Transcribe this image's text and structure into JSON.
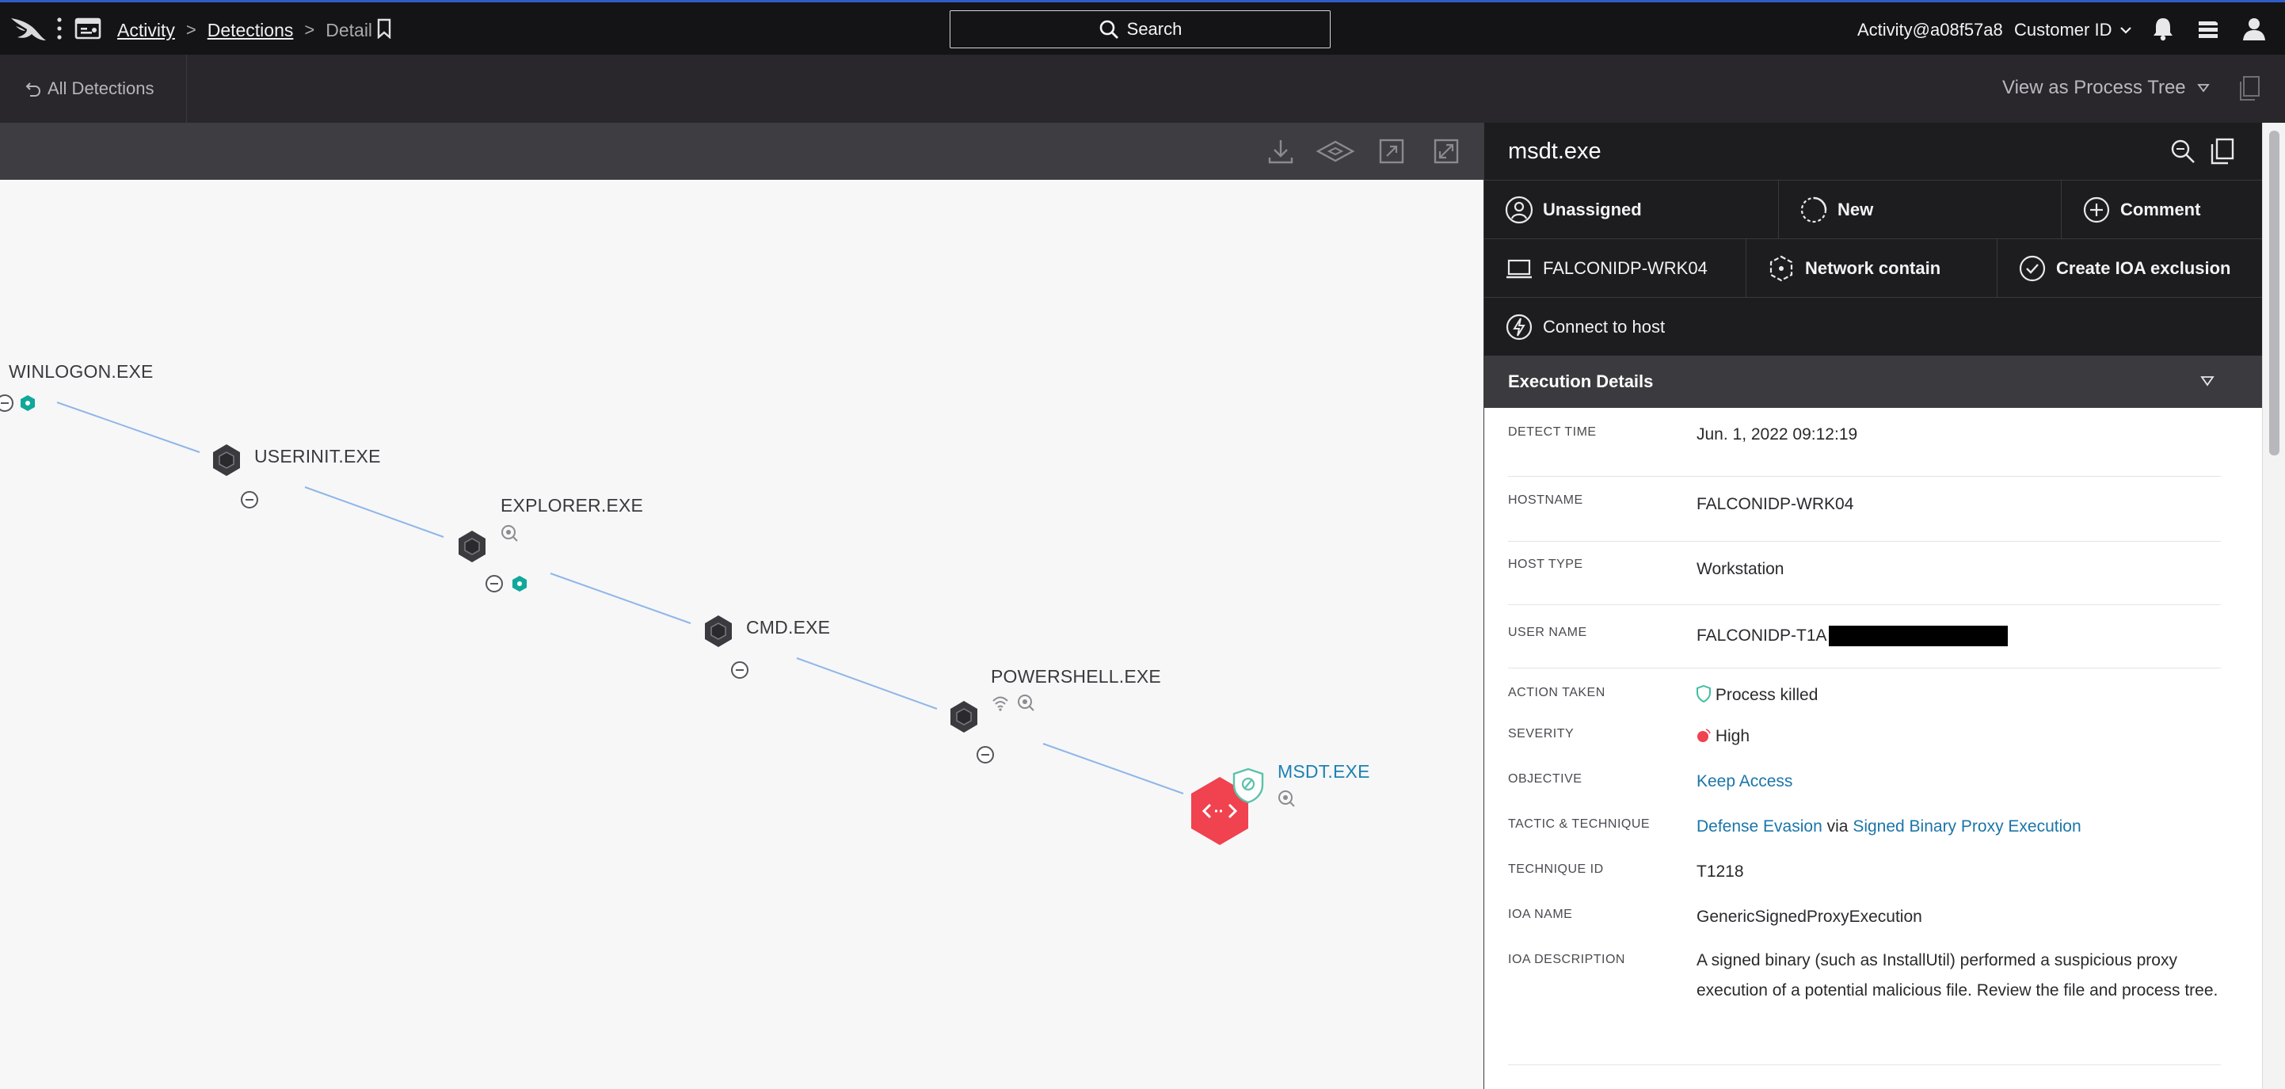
{
  "nav": {
    "breadcrumb": [
      "Activity",
      "Detections",
      "Detail"
    ],
    "search_label": "Search",
    "user": "Activity@a08f57a8",
    "customer_label": "Customer ID"
  },
  "subbar": {
    "back_label": "All Detections",
    "view_label": "View as Process Tree"
  },
  "tree": {
    "nodes": [
      {
        "label": "WINLOGON.EXE"
      },
      {
        "label": "USERINIT.EXE"
      },
      {
        "label": "EXPLORER.EXE"
      },
      {
        "label": "CMD.EXE"
      },
      {
        "label": "POWERSHELL.EXE"
      },
      {
        "label": "MSDT.EXE"
      }
    ]
  },
  "panel": {
    "title": "msdt.exe",
    "actions": {
      "assign": "Unassigned",
      "status": "New",
      "comment": "Comment",
      "host": "FALCONIDP-WRK04",
      "contain": "Network contain",
      "ioa_exclusion": "Create IOA exclusion",
      "connect": "Connect to host"
    },
    "section_title": "Execution Details",
    "details": {
      "detect_time": {
        "label": "DETECT TIME",
        "value": "Jun. 1, 2022 09:12:19"
      },
      "hostname": {
        "label": "HOSTNAME",
        "value": "FALCONIDP-WRK04"
      },
      "host_type": {
        "label": "HOST TYPE",
        "value": "Workstation"
      },
      "user_name": {
        "label": "USER NAME",
        "value": "FALCONIDP-T1A"
      },
      "action_taken": {
        "label": "ACTION TAKEN",
        "value": "Process killed"
      },
      "severity": {
        "label": "SEVERITY",
        "value": "High"
      },
      "objective": {
        "label": "OBJECTIVE",
        "value": "Keep Access"
      },
      "tactic": {
        "label": "TACTIC & TECHNIQUE",
        "tactic": "Defense Evasion",
        "via": "via",
        "technique": "Signed Binary Proxy Execution"
      },
      "technique_id": {
        "label": "TECHNIQUE ID",
        "value": "T1218"
      },
      "ioa_name": {
        "label": "IOA NAME",
        "value": "GenericSignedProxyExecution"
      },
      "ioa_description": {
        "label": "IOA DESCRIPTION",
        "value": "A signed binary (such as InstallUtil) performed a suspicious proxy execution of a potential malicious file. Review the file and process tree."
      }
    }
  },
  "colors": {
    "accent": "#1b82b3",
    "severity_high": "#f0424f",
    "teal": "#10a89a",
    "topbar": "#141315"
  }
}
